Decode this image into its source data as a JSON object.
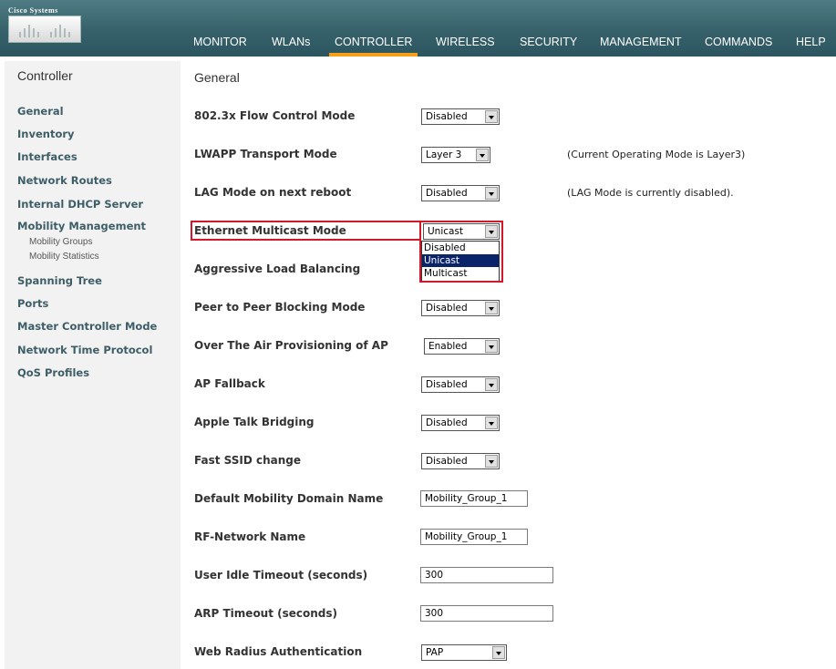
{
  "brand": {
    "logo_text": "Cisco Systems"
  },
  "nav": {
    "items": [
      "MONITOR",
      "WLANs",
      "CONTROLLER",
      "WIRELESS",
      "SECURITY",
      "MANAGEMENT",
      "COMMANDS",
      "HELP"
    ],
    "active": "CONTROLLER",
    "accent_color": "#f6a01a"
  },
  "sidebar": {
    "title": "Controller",
    "items": [
      "General",
      "Inventory",
      "Interfaces",
      "Network Routes",
      "Internal DHCP Server",
      "Mobility Management",
      "Spanning Tree",
      "Ports",
      "Master Controller Mode",
      "Network Time Protocol",
      "QoS Profiles"
    ],
    "mobility_subitems": [
      "Mobility Groups",
      "Mobility Statistics"
    ]
  },
  "main": {
    "title": "General",
    "rows": [
      {
        "label": "802.3x Flow Control Mode",
        "value": "Disabled"
      },
      {
        "label": "LWAPP Transport Mode",
        "value": "Layer 3",
        "note": "(Current Operating Mode is Layer3)"
      },
      {
        "label": "LAG Mode on next reboot",
        "value": "Disabled",
        "note": "(LAG Mode is currently disabled)."
      },
      {
        "label": "Ethernet Multicast Mode",
        "value": "Unicast"
      },
      {
        "label": "Aggressive Load Balancing",
        "value": ""
      },
      {
        "label": "Peer to Peer Blocking Mode",
        "value": "Disabled"
      },
      {
        "label": "Over The Air Provisioning of AP",
        "value": "Enabled"
      },
      {
        "label": "AP Fallback",
        "value": "Disabled"
      },
      {
        "label": "Apple Talk Bridging",
        "value": "Disabled"
      },
      {
        "label": "Fast SSID change",
        "value": "Disabled"
      },
      {
        "label": "Default Mobility Domain Name",
        "value": "Mobility_Group_1"
      },
      {
        "label": "RF-Network Name",
        "value": "Mobility_Group_1"
      },
      {
        "label": "User Idle Timeout (seconds)",
        "value": "300"
      },
      {
        "label": "ARP Timeout (seconds)",
        "value": "300"
      },
      {
        "label": "Web Radius Authentication",
        "value": "PAP"
      }
    ],
    "multicast_dropdown": {
      "options": [
        "Disabled",
        "Unicast",
        "Multicast"
      ],
      "selected": "Unicast"
    },
    "highlight_color": "#d2182b"
  }
}
